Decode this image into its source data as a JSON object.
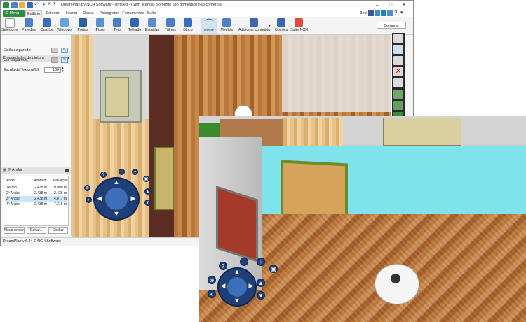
{
  "window": {
    "title": "DreamPlan by NCH Software - Untitled - (Sem licença) Somente uso doméstico não comercial",
    "minimize_icon": "minimize-icon",
    "maximize_icon": "maximize-icon",
    "close_icon": "close-icon"
  },
  "menu_label": "Menu",
  "tabs": [
    "Edifício",
    "Exterior",
    "Interior",
    "Decks",
    "Paisagismo",
    "Ferramentas",
    "Suíte"
  ],
  "beta_label": "Beta",
  "ribbon": {
    "buttons": [
      "Selecione",
      "Paredes",
      "Quartos",
      "Windows",
      "Portas",
      "Pisos",
      "Teto",
      "Telhado",
      "Escadas",
      "Trilhos",
      "Bloco",
      "Pintar",
      "Medida",
      "Adicionar conteúdo",
      "Opções",
      "Suite NCH"
    ],
    "selected": "Pintar",
    "buy_label": "Comprar"
  },
  "paint_panel": {
    "title": "Propriedades de pintura",
    "wall_style_label": "Estilo de parede:",
    "wall_color_label": "Cor da parede:",
    "texture_scale_label": "Escala de Textura(%):",
    "texture_scale_value": "100"
  },
  "floor_panel": {
    "title": "3º Andar",
    "columns": [
      "Andar",
      "Altura d...",
      "Elevação"
    ],
    "rows": [
      [
        "Térreo",
        "2.438 m",
        "0.000 m"
      ],
      [
        "2º Andar",
        "2.438 m",
        "2.438 m"
      ],
      [
        "3º Andar",
        "2.438 m",
        "4.877 m"
      ],
      [
        "4º Andar",
        "2.438 m",
        "7.315 m"
      ]
    ],
    "selected_index": 2,
    "buttons": [
      "Novo Andar",
      "Editar...",
      "Excluir"
    ]
  },
  "status_text": "DreamPlan v 6.44 © NCH Software",
  "colors": {
    "menu_green": "#2f8d3f",
    "nav_blue": "#1f3f78",
    "pool_water": "#7fe3ec",
    "wood": "#b9763d"
  }
}
